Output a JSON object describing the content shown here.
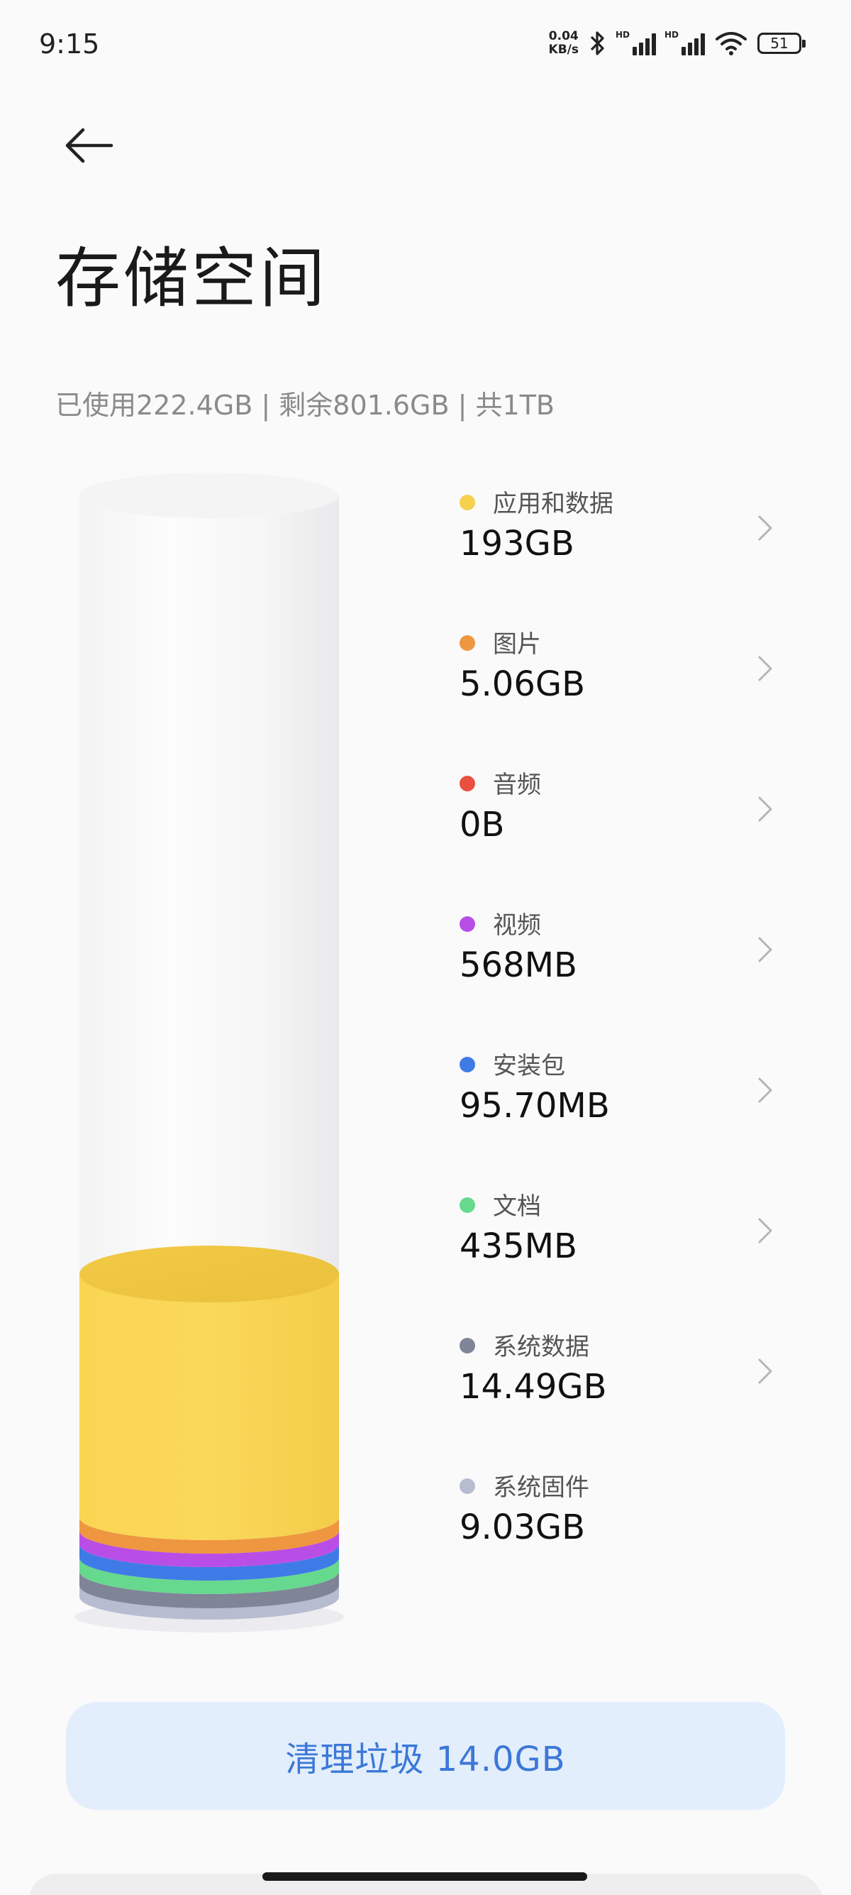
{
  "status_bar": {
    "time": "9:15",
    "net_speed_value": "0.04",
    "net_speed_unit": "KB/s",
    "bluetooth_icon": "bluetooth-icon",
    "signal_1_label": "HD",
    "signal_2_label": "HD",
    "wifi_icon": "wifi-icon",
    "battery_level": "51"
  },
  "header": {
    "back_icon": "arrow-left-icon",
    "title": "存储空间"
  },
  "summary": "已使用222.4GB | 剩余801.6GB | 共1TB",
  "categories": [
    {
      "label": "应用和数据",
      "value": "193GB",
      "color": "#f5d04c",
      "has_chevron": true
    },
    {
      "label": "图片",
      "value": "5.06GB",
      "color": "#ef9640",
      "has_chevron": true
    },
    {
      "label": "音频",
      "value": "0B",
      "color": "#e9503f",
      "has_chevron": true
    },
    {
      "label": "视频",
      "value": "568MB",
      "color": "#b94ee6",
      "has_chevron": true
    },
    {
      "label": "安装包",
      "value": "95.70MB",
      "color": "#3f7be6",
      "has_chevron": true
    },
    {
      "label": "文档",
      "value": "435MB",
      "color": "#66d98f",
      "has_chevron": true
    },
    {
      "label": "系统数据",
      "value": "14.49GB",
      "color": "#808497",
      "has_chevron": true
    },
    {
      "label": "系统固件",
      "value": "9.03GB",
      "color": "#b8bcd1",
      "has_chevron": false
    }
  ],
  "clean_button": {
    "label": "清理垃圾 14.0GB",
    "accent": "#3c78d8",
    "background": "#e3eefc"
  }
}
